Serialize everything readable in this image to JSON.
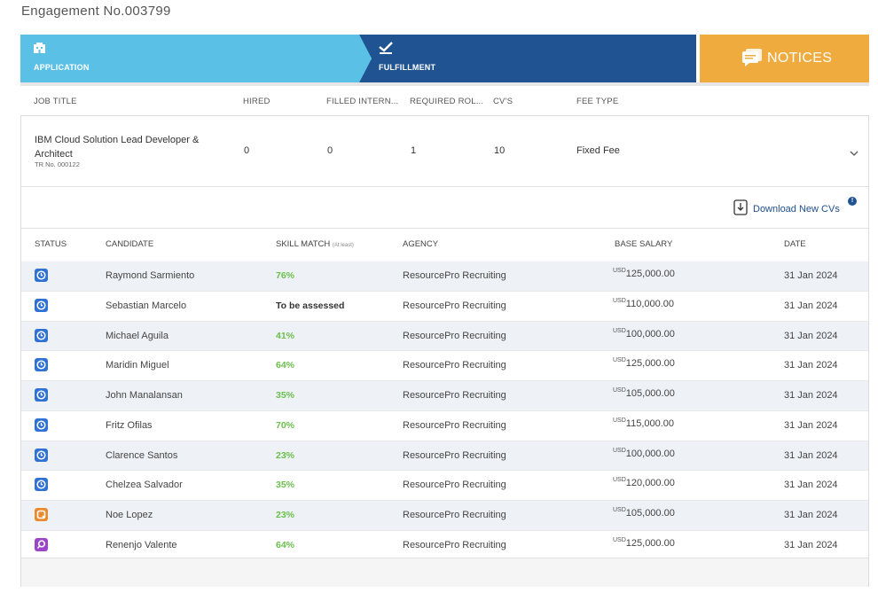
{
  "engagement_title": "Engagement No.003799",
  "steps": {
    "application_label": "APPLICATION",
    "fulfillment_label": "FULFILLMENT",
    "notices_label": "NOTICES"
  },
  "job_table": {
    "headers": [
      "JOB TITLE",
      "HIRED",
      "FILLED INTERN...",
      "REQUIRED ROL...",
      "CV'S",
      "FEE TYPE"
    ],
    "row": {
      "title": "IBM Cloud Solution Lead Developer & Architect",
      "tr_no": "TR No. 000122",
      "hired": "0",
      "filled_internally": "0",
      "required_roles": "1",
      "cvs": "10",
      "fee_type": "Fixed Fee"
    }
  },
  "download_label": "Download New CVs",
  "download_badge": "!",
  "candidate_headers": {
    "status": "STATUS",
    "candidate": "CANDIDATE",
    "skill_match": "SKILL MATCH",
    "skill_match_note": "(At least)",
    "agency": "AGENCY",
    "base_salary": "BASE SALARY",
    "date": "DATE"
  },
  "colors": {
    "status_pending": "#2f72d3",
    "status_review": "#e88a2d",
    "status_search": "#9b45c8",
    "skill_green": "#6bbf4c",
    "application_step": "#5bc0e6",
    "fulfillment_step": "#1f5391",
    "notices": "#f0ab3e"
  },
  "candidates": [
    {
      "status": "clock-icon",
      "status_color": "#2f72d3",
      "name": "Raymond Sarmiento",
      "skill": "76%",
      "agency": "ResourcePro Recruiting",
      "currency": "USD",
      "salary": "125,000.00",
      "date": "31 Jan 2024"
    },
    {
      "status": "clock-icon",
      "status_color": "#2f72d3",
      "name": "Sebastian Marcelo",
      "skill": "To be assessed",
      "agency": "ResourcePro Recruiting",
      "currency": "USD",
      "salary": "110,000.00",
      "date": "31 Jan 2024"
    },
    {
      "status": "clock-icon",
      "status_color": "#2f72d3",
      "name": "Michael Aguila",
      "skill": "41%",
      "agency": "ResourcePro Recruiting",
      "currency": "USD",
      "salary": "100,000.00",
      "date": "31 Jan 2024"
    },
    {
      "status": "clock-icon",
      "status_color": "#2f72d3",
      "name": "Maridin Miguel",
      "skill": "64%",
      "agency": "ResourcePro Recruiting",
      "currency": "USD",
      "salary": "125,000.00",
      "date": "31 Jan 2024"
    },
    {
      "status": "clock-icon",
      "status_color": "#2f72d3",
      "name": "John Manalansan",
      "skill": "35%",
      "agency": "ResourcePro Recruiting",
      "currency": "USD",
      "salary": "105,000.00",
      "date": "31 Jan 2024"
    },
    {
      "status": "clock-icon",
      "status_color": "#2f72d3",
      "name": "Fritz Ofilas",
      "skill": "70%",
      "agency": "ResourcePro Recruiting",
      "currency": "USD",
      "salary": "115,000.00",
      "date": "31 Jan 2024"
    },
    {
      "status": "clock-icon",
      "status_color": "#2f72d3",
      "name": "Clarence Santos",
      "skill": "23%",
      "agency": "ResourcePro Recruiting",
      "currency": "USD",
      "salary": "100,000.00",
      "date": "31 Jan 2024"
    },
    {
      "status": "clock-icon",
      "status_color": "#2f72d3",
      "name": "Chelzea Salvador",
      "skill": "35%",
      "agency": "ResourcePro Recruiting",
      "currency": "USD",
      "salary": "120,000.00",
      "date": "31 Jan 2024"
    },
    {
      "status": "review-icon",
      "status_color": "#e88a2d",
      "name": "Noe Lopez",
      "skill": "23%",
      "agency": "ResourcePro Recruiting",
      "currency": "USD",
      "salary": "105,000.00",
      "date": "31 Jan 2024"
    },
    {
      "status": "search-icon",
      "status_color": "#9b45c8",
      "name": "Renenjo Valente",
      "skill": "64%",
      "agency": "ResourcePro Recruiting",
      "currency": "USD",
      "salary": "125,000.00",
      "date": "31 Jan 2024"
    }
  ]
}
